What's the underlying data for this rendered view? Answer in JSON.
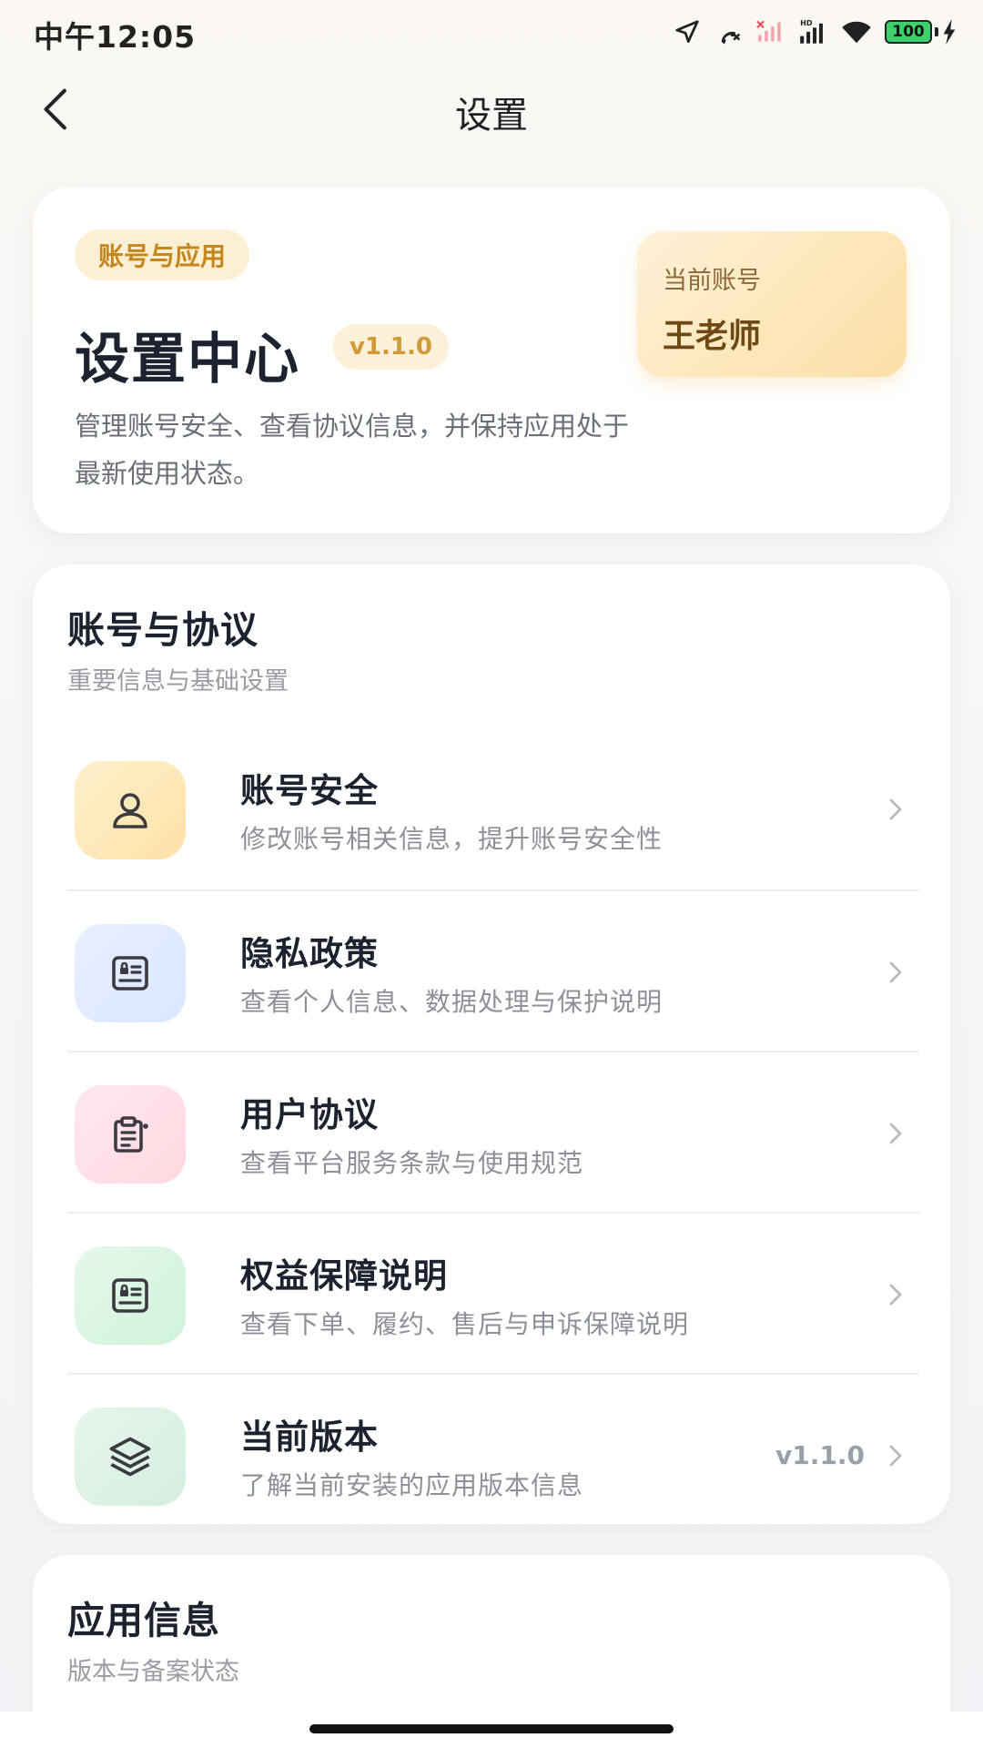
{
  "status_bar": {
    "time": "中午12:05",
    "battery": "100",
    "icons": [
      "location-icon",
      "missed-call-icon",
      "signal-off-icon",
      "signal-hd-icon",
      "wifi-icon",
      "battery-icon",
      "charging-icon"
    ]
  },
  "nav": {
    "back_icon": "chevron-left-icon",
    "title": "设置"
  },
  "hero": {
    "tag": "账号与应用",
    "title": "设置中心",
    "version": "v1.1.0",
    "description": "管理账号安全、查看协议信息，并保持应用处于最新使用状态。",
    "account_label": "当前账号",
    "account_name": "王老师"
  },
  "menu_section": {
    "title": "账号与协议",
    "subtitle": "重要信息与基础设置",
    "items": [
      {
        "title": "账号安全",
        "subtitle": "修改账号相关信息，提升账号安全性",
        "icon": "user-icon",
        "value": ""
      },
      {
        "title": "隐私政策",
        "subtitle": "查看个人信息、数据处理与保护说明",
        "icon": "privacy-doc-icon",
        "value": ""
      },
      {
        "title": "用户协议",
        "subtitle": "查看平台服务条款与使用规范",
        "icon": "clipboard-icon",
        "value": ""
      },
      {
        "title": "权益保障说明",
        "subtitle": "查看下单、履约、售后与申诉保障说明",
        "icon": "shield-doc-icon",
        "value": ""
      },
      {
        "title": "当前版本",
        "subtitle": "了解当前安装的应用版本信息",
        "icon": "layers-icon",
        "value": "v1.1.0"
      }
    ]
  },
  "info_section": {
    "title": "应用信息",
    "subtitle": "版本与备案状态"
  },
  "colors": {
    "accent_orange": "#c5861b",
    "account_text": "#6d4a14",
    "title_dark": "#1e2230",
    "sub_gray": "#8d9098"
  }
}
